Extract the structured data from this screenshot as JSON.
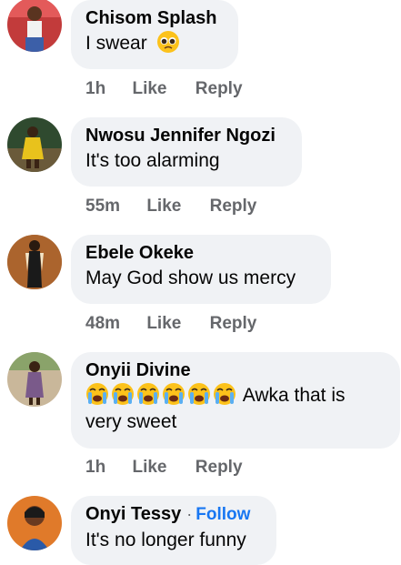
{
  "comments": [
    {
      "author": "Chisom Splash",
      "text": "I swear",
      "emoji": "pleading-face-emoji",
      "time": "1h",
      "like": "Like",
      "reply": "Reply"
    },
    {
      "author": "Nwosu Jennifer Ngozi",
      "text": "It's too alarming",
      "time": "55m",
      "like": "Like",
      "reply": "Reply"
    },
    {
      "author": "Ebele Okeke",
      "text": "May God show us mercy",
      "time": "48m",
      "like": "Like",
      "reply": "Reply"
    },
    {
      "author": "Onyii Divine",
      "text_line1": "Awka that is",
      "text_line2": "very sweet",
      "emoji": "loudly-crying-face-emoji",
      "emoji_count": 6,
      "time": "1h",
      "like": "Like",
      "reply": "Reply"
    },
    {
      "author": "Onyi Tessy",
      "separator": "·",
      "follow": "Follow",
      "text": "It's no longer funny"
    }
  ],
  "colors": {
    "bubble": "#f0f2f5",
    "secondary_text": "#65676b",
    "link": "#1877f2",
    "primary_text": "#050505"
  }
}
